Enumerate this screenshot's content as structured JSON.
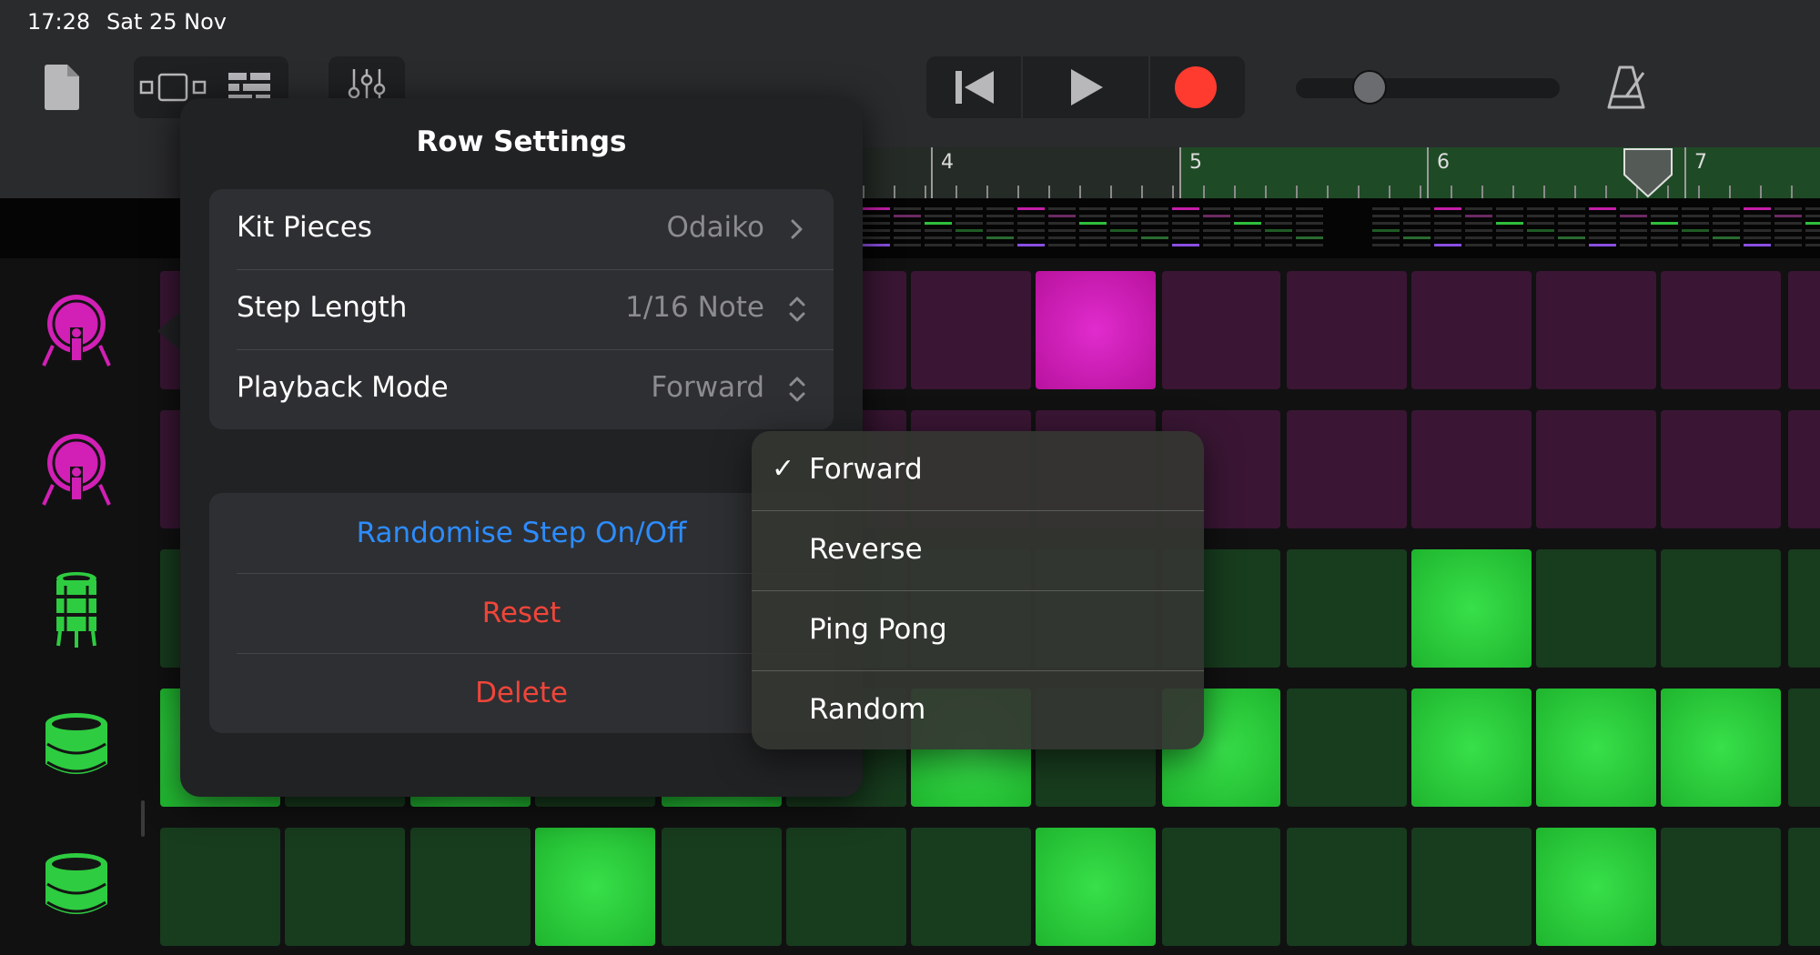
{
  "status_bar": {
    "time": "17:28",
    "date": "Sat 25 Nov"
  },
  "toolbar": {
    "icons": [
      "document-icon",
      "view-toggle-icon",
      "tracks-view-icon",
      "mixer-icon",
      "skip-back-icon",
      "play-icon",
      "record-icon",
      "master-volume-slider",
      "metronome-icon"
    ],
    "record_color": "#ff3b30",
    "master_volume": 0.22
  },
  "ruler": {
    "bars": [
      "4",
      "5",
      "6",
      "7"
    ]
  },
  "rows": [
    {
      "icon": "odaiko-drum-icon",
      "color": "#d21fb5"
    },
    {
      "icon": "odaiko-drum-icon",
      "color": "#d21fb5"
    },
    {
      "icon": "snare-drum-icon",
      "color": "#2ecc40"
    },
    {
      "icon": "taiko-drum-icon",
      "color": "#2ecc40"
    },
    {
      "icon": "taiko-drum-icon",
      "color": "#2ecc40"
    }
  ],
  "row_settings": {
    "title": "Row Settings",
    "kit_pieces": {
      "label": "Kit Pieces",
      "value": "Odaiko"
    },
    "step_length": {
      "label": "Step Length",
      "value": "1/16 Note"
    },
    "playback_mode": {
      "label": "Playback Mode",
      "value": "Forward"
    },
    "actions": {
      "randomise": "Randomise Step On/Off",
      "reset": "Reset",
      "delete": "Delete"
    },
    "colors": {
      "accent": "#2d8cff",
      "destructive": "#f0453a"
    }
  },
  "playback_menu": {
    "options": [
      "Forward",
      "Reverse",
      "Ping Pong",
      "Random"
    ],
    "selected": "Forward",
    "check": "✓"
  }
}
